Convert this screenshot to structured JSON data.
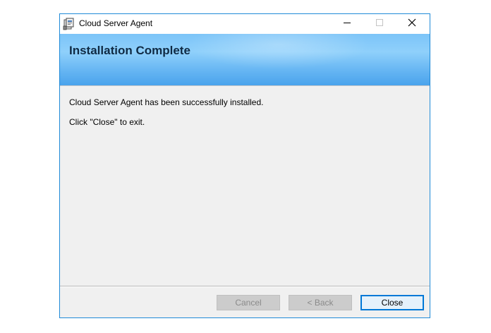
{
  "window": {
    "title": "Cloud Server Agent",
    "accent_color": "#1f8ad8"
  },
  "titlebar": {
    "app_icon": "installer-icon",
    "controls": {
      "minimize": "minimize-icon",
      "maximize": "maximize-icon",
      "close": "close-icon"
    }
  },
  "banner": {
    "title": "Installation Complete",
    "color": "#62b3f2"
  },
  "content": {
    "message": "Cloud Server Agent has been successfully installed.",
    "instruction": "Click \"Close\" to exit."
  },
  "buttons": {
    "cancel": {
      "label": "Cancel",
      "enabled": false
    },
    "back": {
      "label": "< Back",
      "enabled": false
    },
    "close": {
      "label": "Close",
      "enabled": true
    }
  }
}
